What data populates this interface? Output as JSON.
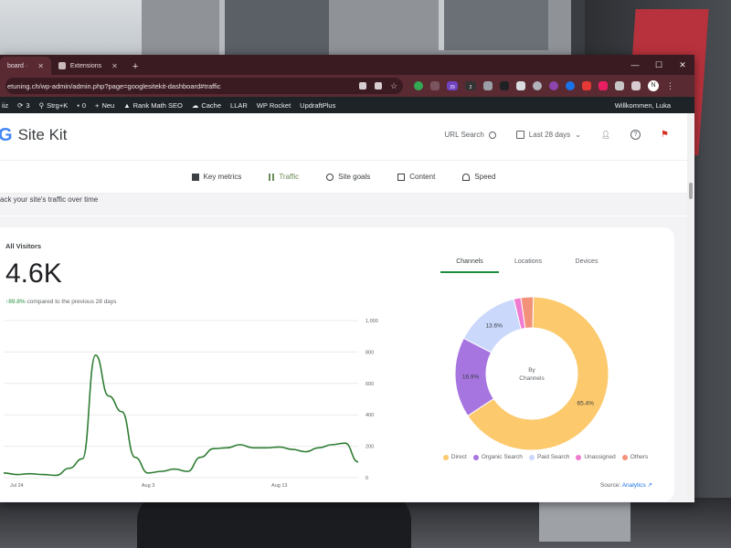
{
  "browser": {
    "tabs": [
      {
        "label": "board ·",
        "active": true
      },
      {
        "label": "Extensions",
        "active": false
      }
    ],
    "new_tab": "+",
    "window_controls": {
      "minimize": "—",
      "maximize": "☐",
      "close": "✕"
    },
    "url": "etuning.ch/wp-admin/admin.php?page=googlesitekit-dashboard#traffic",
    "extension_badges": {
      "b1": "29",
      "b2": "2"
    },
    "profile_initial": "N",
    "menu": "⋮"
  },
  "wp_admin_bar": {
    "items": [
      {
        "label": "iiz"
      },
      {
        "label": "3"
      },
      {
        "label": "Strg+K"
      },
      {
        "label": "0"
      },
      {
        "label": "Neu"
      },
      {
        "label": "Rank Math SEO"
      },
      {
        "label": "Cache"
      },
      {
        "label": "LLAR"
      },
      {
        "label": "WP Rocket"
      },
      {
        "label": "UpdraftPlus"
      }
    ],
    "welcome": "Willkommen, Luka"
  },
  "sitekit": {
    "logo_g": "G",
    "logo_text": "Site Kit",
    "url_search": "URL Search",
    "date_range": "Last 28 days",
    "nav": [
      {
        "label": "Key metrics",
        "selected": false
      },
      {
        "label": "Traffic",
        "selected": true
      },
      {
        "label": "Site goals",
        "selected": false
      },
      {
        "label": "Content",
        "selected": false
      },
      {
        "label": "Speed",
        "selected": false
      }
    ],
    "section_subtitle": "ack your site's traffic over time",
    "visitors": {
      "label": "All Visitors",
      "value": "4.6K",
      "change": "89.8%",
      "change_text": "compared to the previous 28 days"
    },
    "donut_tabs": [
      "Channels",
      "Locations",
      "Devices"
    ],
    "donut_center": "By\nChannels",
    "source_label": "Source:",
    "source_link": "Analytics"
  },
  "chart_data": [
    {
      "type": "line",
      "title": "",
      "xlabel": "",
      "ylabel": "",
      "ylim": [
        0,
        1000
      ],
      "y_ticks": [
        "0",
        "200",
        "400",
        "600",
        "800",
        "1,000"
      ],
      "x_tick_labels": [
        {
          "label": "Jul 24",
          "index": 1
        },
        {
          "label": "Aug 3",
          "index": 11
        },
        {
          "label": "Aug 13",
          "index": 21
        }
      ],
      "series": [
        {
          "color": "#2e7d32",
          "values": [
            30,
            20,
            25,
            20,
            15,
            60,
            120,
            780,
            520,
            420,
            130,
            30,
            40,
            55,
            40,
            130,
            185,
            190,
            210,
            190,
            190,
            195,
            180,
            165,
            190,
            210,
            220,
            100
          ]
        }
      ],
      "grid": true
    },
    {
      "type": "pie",
      "donut": true,
      "slices": [
        {
          "label": "Direct",
          "value": 65.4,
          "display": "65.4%",
          "color": "#fcc96c"
        },
        {
          "label": "Organic Search",
          "value": 16.9,
          "display": "16.9%",
          "color": "#a775e0"
        },
        {
          "label": "Paid Search",
          "value": 13.6,
          "display": "13.6%",
          "color": "#c9d8fb"
        },
        {
          "label": "Unassigned",
          "value": 1.5,
          "display": "",
          "color": "#f07ad0"
        },
        {
          "label": "Others",
          "value": 2.6,
          "display": "",
          "color": "#f3927b"
        }
      ]
    }
  ]
}
